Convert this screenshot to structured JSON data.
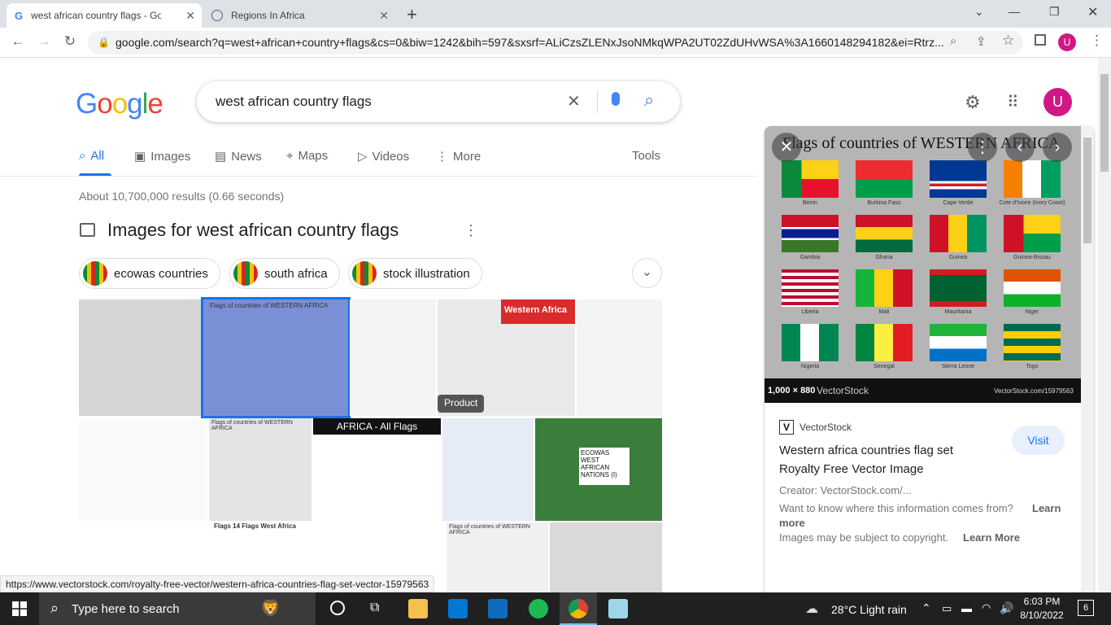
{
  "browser": {
    "tabs": [
      {
        "title": "west african country flags - Goog",
        "close": "✕"
      },
      {
        "title": "Regions In Africa",
        "close": "✕"
      }
    ],
    "new_tab": "+",
    "url": "google.com/search?q=west+african+country+flags&cs=0&biw=1242&bih=597&sxsrf=ALiCzsZLENxJsoNMkqWPA2UT02ZdUHvWSA%3A1660148294182&ei=Rtrz...",
    "profile_initial": "U"
  },
  "search": {
    "logo": "Google",
    "query": "west african country flags",
    "clear": "✕",
    "tabs": [
      "All",
      "Images",
      "News",
      "Maps",
      "Videos",
      "More"
    ],
    "tools": "Tools",
    "stats": "About 10,700,000 results (0.66 seconds)",
    "profile_initial": "U"
  },
  "images_section": {
    "title": "Images for west african country flags",
    "chips": [
      "ecowas countries",
      "south africa",
      "stock illustration"
    ],
    "product_badge": "Product",
    "thumb_titles": [
      "Flags of countries of WESTERN AFRICA",
      "Western Africa",
      "AFRICA - All Flags",
      "ECOWAS WEST AFRICAN NATIONS (I)",
      "Flags 14 Flags West Africa",
      "Flags of countries of WESTERN AFRICA",
      "Western Africa"
    ]
  },
  "panel": {
    "preview_title": "Flags of countries of WESTERN AFRICA",
    "flags": [
      "Benin",
      "Burkina Faso",
      "Cape Verde",
      "Cote d'Ivoire (Ivory Coast)",
      "Gambia",
      "Ghana",
      "Guinea",
      "Guinea-Bissau",
      "Liberia",
      "Mali",
      "Mauritania",
      "Niger",
      "Nigeria",
      "Senegal",
      "Sierra Leone",
      "Togo"
    ],
    "dimensions": "1,000 × 880",
    "watermark": "VectorStock",
    "watermark_url": "VectorStock.com/15979563",
    "source": "VectorStock",
    "visit": "Visit",
    "title_line1": "Western africa countries flag set",
    "title_line2": "Royalty Free Vector Image",
    "creator": "Creator: VectorStock.com/...",
    "info": "Want to know where this information comes from?",
    "learn_more": "Learn more",
    "copyright": "Images may be subject to copyright.",
    "learn_more2": "Learn More"
  },
  "status_url": "https://www.vectorstock.com/royalty-free-vector/western-africa-countries-flag-set-vector-15979563",
  "taskbar": {
    "search_placeholder": "Type here to search",
    "weather": "28°C  Light rain",
    "time": "6:03 PM",
    "date": "8/10/2022",
    "notifications": "6"
  }
}
